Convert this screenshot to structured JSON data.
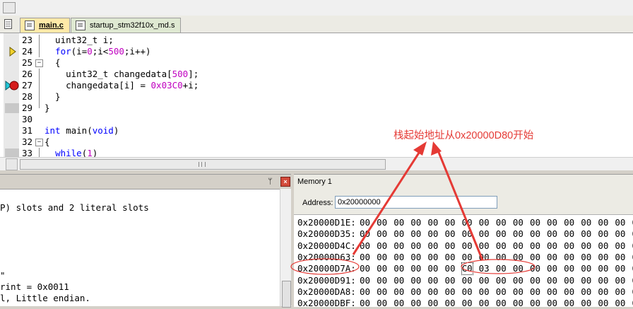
{
  "tabs": [
    {
      "label": "main.c",
      "active": true
    },
    {
      "label": "startup_stm32f10x_md.s",
      "active": false
    }
  ],
  "code": [
    {
      "line": "23",
      "text": "  uint32_t i;"
    },
    {
      "line": "24",
      "text": "  for(i=0;i<500;i++)",
      "marker": "current-arrow"
    },
    {
      "line": "25",
      "text": "  {"
    },
    {
      "line": "26",
      "text": "    uint32_t changedata[500];"
    },
    {
      "line": "27",
      "text": "    changedata[i] = 0x03C0+i;",
      "marker": "breakpoint-arrow"
    },
    {
      "line": "28",
      "text": "  }"
    },
    {
      "line": "29",
      "text": "}"
    },
    {
      "line": "30",
      "text": ""
    },
    {
      "line": "31",
      "text": "int main(void)"
    },
    {
      "line": "32",
      "text": "{"
    },
    {
      "line": "33",
      "text": "  while(1)"
    }
  ],
  "output_panel": {
    "lines": [
      "P) slots and 2 literal slots",
      "",
      "",
      "",
      "\"",
      "rint = 0x0011",
      "l, Little endian."
    ]
  },
  "memory": {
    "title": "Memory 1",
    "address_label": "Address:",
    "address_value": "0x20000000",
    "rows": [
      {
        "addr": "0x20000D1E:",
        "bytes": [
          "00",
          "00",
          "00",
          "00",
          "00",
          "00",
          "00",
          "00",
          "00",
          "00",
          "00",
          "00",
          "00",
          "00",
          "00",
          "00",
          "00"
        ]
      },
      {
        "addr": "0x20000D35:",
        "bytes": [
          "00",
          "00",
          "00",
          "00",
          "00",
          "00",
          "00",
          "00",
          "00",
          "00",
          "00",
          "00",
          "00",
          "00",
          "00",
          "00",
          "00"
        ]
      },
      {
        "addr": "0x20000D4C:",
        "bytes": [
          "00",
          "00",
          "00",
          "00",
          "00",
          "00",
          "00",
          "00",
          "00",
          "00",
          "00",
          "00",
          "00",
          "00",
          "00",
          "00",
          "00"
        ]
      },
      {
        "addr": "0x20000D63:",
        "bytes": [
          "00",
          "00",
          "00",
          "00",
          "00",
          "00",
          "00",
          "00",
          "00",
          "00",
          "00",
          "00",
          "00",
          "00",
          "00",
          "00",
          "00"
        ]
      },
      {
        "addr": "0x20000D7A:",
        "bytes": [
          "00",
          "00",
          "00",
          "00",
          "00",
          "00",
          "C0",
          "03",
          "00",
          "00",
          "00",
          "00",
          "00",
          "00",
          "00",
          "00",
          "00"
        ]
      },
      {
        "addr": "0x20000D91:",
        "bytes": [
          "00",
          "00",
          "00",
          "00",
          "00",
          "00",
          "00",
          "00",
          "00",
          "00",
          "00",
          "00",
          "00",
          "00",
          "00",
          "00",
          "00"
        ]
      },
      {
        "addr": "0x20000DA8:",
        "bytes": [
          "00",
          "00",
          "00",
          "00",
          "00",
          "00",
          "00",
          "00",
          "00",
          "00",
          "00",
          "00",
          "00",
          "00",
          "00",
          "00",
          "00"
        ]
      },
      {
        "addr": "0x20000DBF:",
        "bytes": [
          "00",
          "00",
          "00",
          "00",
          "00",
          "00",
          "00",
          "00",
          "00",
          "00",
          "00",
          "00",
          "00",
          "00",
          "00",
          "00",
          "00"
        ]
      }
    ]
  },
  "annotation": {
    "text": "栈起始地址从0x20000D80开始",
    "color": "#e53a35"
  },
  "icons": [
    "document-icon",
    "pin-icon",
    "close-icon",
    "current-line-arrow-icon",
    "breakpoint-icon",
    "fold-toggle-icon"
  ]
}
